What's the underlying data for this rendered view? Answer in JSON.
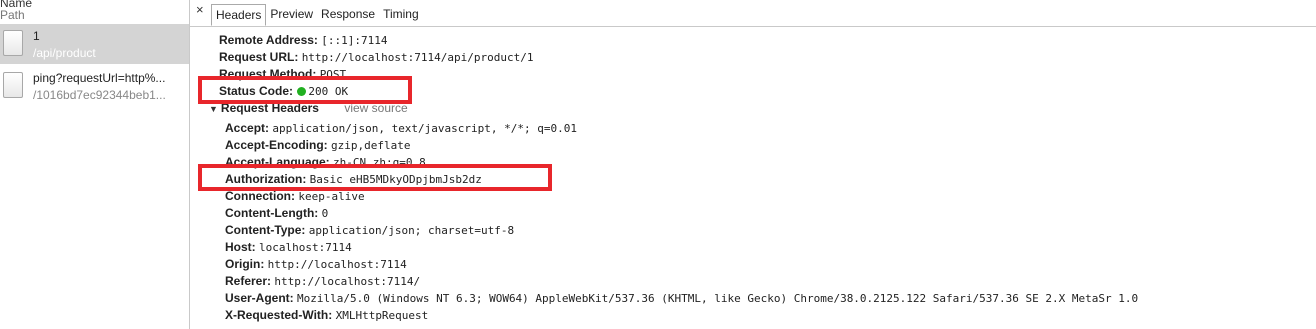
{
  "list": {
    "header_name": "Name",
    "header_path": "Path",
    "requests": [
      {
        "name": "1",
        "path": "/api/product"
      },
      {
        "name": "ping?requestUrl=http%...",
        "path": "/1016bd7ec92344beb1..."
      }
    ]
  },
  "tabs": {
    "close": "×",
    "items": [
      "Headers",
      "Preview",
      "Response",
      "Timing"
    ],
    "active": "Headers"
  },
  "general": {
    "remote_address_key": "Remote Address:",
    "remote_address_val": "[::1]:7114",
    "request_url_key": "Request URL:",
    "request_url_val": "http://localhost:7114/api/product/1",
    "request_method_key": "Request Method:",
    "request_method_val": "POST",
    "status_code_key": "Status Code:",
    "status_code_val": "200 OK"
  },
  "request_headers": {
    "title": "Request Headers",
    "view_source": "view source",
    "items": [
      {
        "k": "Accept:",
        "v": "application/json, text/javascript, */*; q=0.01"
      },
      {
        "k": "Accept-Encoding:",
        "v": "gzip,deflate"
      },
      {
        "k": "Accept-Language:",
        "v": "zh-CN,zh;q=0.8"
      },
      {
        "k": "Authorization:",
        "v": "Basic eHB5MDkyODpjbmJsb2dz"
      },
      {
        "k": "Connection:",
        "v": "keep-alive"
      },
      {
        "k": "Content-Length:",
        "v": "0"
      },
      {
        "k": "Content-Type:",
        "v": "application/json; charset=utf-8"
      },
      {
        "k": "Host:",
        "v": "localhost:7114"
      },
      {
        "k": "Origin:",
        "v": "http://localhost:7114"
      },
      {
        "k": "Referer:",
        "v": "http://localhost:7114/"
      },
      {
        "k": "User-Agent:",
        "v": "Mozilla/5.0 (Windows NT 6.3; WOW64) AppleWebKit/537.36 (KHTML, like Gecko) Chrome/38.0.2125.122 Safari/537.36 SE 2.X MetaSr 1.0"
      },
      {
        "k": "X-Requested-With:",
        "v": "XMLHttpRequest"
      }
    ]
  },
  "colors": {
    "highlight": "#e8262b",
    "status_ok": "#21b021"
  }
}
